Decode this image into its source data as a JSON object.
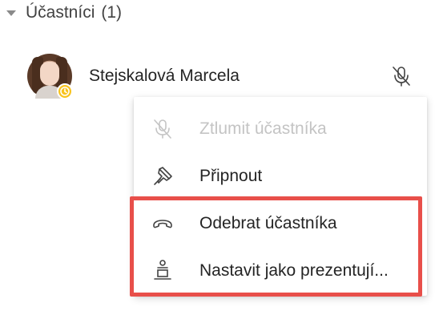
{
  "section": {
    "title": "Účastníci",
    "count": "(1)"
  },
  "participant": {
    "name": "Stejskalová Marcela",
    "status": "away",
    "status_color": "#f8c31d"
  },
  "menu": {
    "items": [
      {
        "label": "Ztlumit účastníka",
        "icon": "mic-off-icon",
        "disabled": true
      },
      {
        "label": "Připnout",
        "icon": "pin-icon",
        "disabled": false
      },
      {
        "label": "Odebrat účastníka",
        "icon": "hang-up-icon",
        "disabled": false
      },
      {
        "label": "Nastavit jako prezentují...",
        "icon": "presenter-icon",
        "disabled": false
      }
    ]
  },
  "colors": {
    "highlight": "#e84f4a",
    "text": "#242424",
    "disabled_text": "#c4c4c4"
  }
}
